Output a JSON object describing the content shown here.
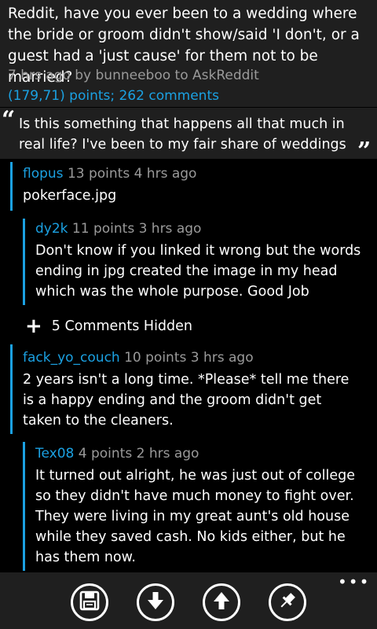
{
  "post": {
    "title": "Reddit, have you ever been to a wedding where the bride or groom didn't show/said 'I don't, or a guest had a 'just cause' for them not to be married?",
    "meta": "7 hrs ago by bunneeboo to AskReddit",
    "stats": "(179,71) points; 262 comments",
    "selftext": "Is this something that happens all that much in real life? I've been to my fair share of weddings",
    "quote_open": "“",
    "quote_close": "”"
  },
  "comments": [
    {
      "author": "flopus",
      "info": "13 points 4 hrs ago",
      "body": "pokerface.jpg"
    },
    {
      "author": "dy2k",
      "info": "11 points 3 hrs ago",
      "body": "Don't know if you linked it wrong but the words ending in jpg created the image in my head which was the whole purpose. Good Job"
    },
    {
      "author": "fack_yo_couch",
      "info": "10 points 3 hrs ago",
      "body": "2 years isn't a long time. *Please* tell me there is a happy ending and the groom didn't get taken to the cleaners."
    },
    {
      "author": "Tex08",
      "info": "4 points 2 hrs ago",
      "body": "It turned out alright, he was just out of college so they didn't have much money to fight over. They were living in my great aunt's old house while they saved cash. No kids either, but he has them now."
    }
  ],
  "hidden": {
    "icon": "+",
    "label": "5 Comments Hidden"
  },
  "appbar": {
    "buttons": [
      {
        "icon": "save-icon"
      },
      {
        "icon": "downvote-icon"
      },
      {
        "icon": "upvote-icon"
      },
      {
        "icon": "pin-icon"
      }
    ],
    "more": "•••"
  },
  "colors": {
    "accent": "#1ba1e2",
    "meta": "#9a9a9a",
    "panel": "#1f1f1f",
    "background": "#000000"
  }
}
